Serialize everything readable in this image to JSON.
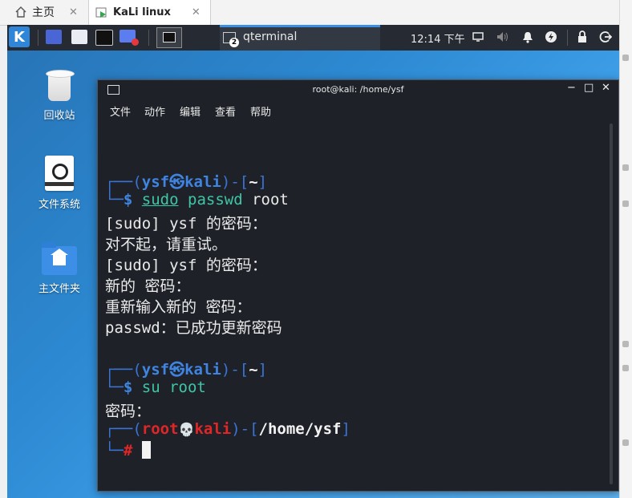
{
  "vm_tabs": [
    {
      "label": "主页",
      "close": "✕"
    },
    {
      "label": "KaLi linux",
      "close": "✕"
    }
  ],
  "panel": {
    "task_label": "qterminal",
    "task_badge": "2",
    "clock": "12:14 下午"
  },
  "desktop": {
    "icons": [
      {
        "label": "回收站"
      },
      {
        "label": "文件系统"
      },
      {
        "label": "主文件夹"
      }
    ]
  },
  "terminal": {
    "title": "root@kali: /home/ysf",
    "window_buttons": [
      "−",
      "□",
      "✕"
    ],
    "menu": [
      "文件",
      "动作",
      "编辑",
      "查看",
      "帮助"
    ],
    "session1": {
      "box_open": "┌──(",
      "user": "ysf",
      "at": "㉿",
      "host": "kali",
      "close_paren": ")-[",
      "dir": "~",
      "close_bracket": "]",
      "box_close": "└─",
      "prompt": "$",
      "cmd_a": "sudo",
      "cmd_b": " passwd",
      "cmd_c": " root"
    },
    "output1": [
      "[sudo] ysf 的密码：",
      "对不起，请重试。",
      "[sudo] ysf 的密码：",
      "新的 密码：",
      "重新输入新的 密码：",
      "passwd：已成功更新密码"
    ],
    "session2": {
      "box_open": "┌──(",
      "user": "ysf",
      "at": "㉿",
      "host": "kali",
      "close_paren": ")-[",
      "dir": "~",
      "close_bracket": "]",
      "box_close": "└─",
      "prompt": "$",
      "cmd": " su root"
    },
    "output2": [
      "密码："
    ],
    "session3": {
      "box_open": "┌──(",
      "user": "root",
      "at": "💀",
      "host": "kali",
      "close_paren": ")-[",
      "dir": "/home/ysf",
      "close_bracket": "]",
      "box_close": "└─",
      "prompt": "#"
    }
  },
  "colors": {
    "terminal_bg": "#1e2228",
    "panel_bg": "#262b33",
    "prompt_blue": "#3a74d6",
    "root_red": "#e02626"
  }
}
